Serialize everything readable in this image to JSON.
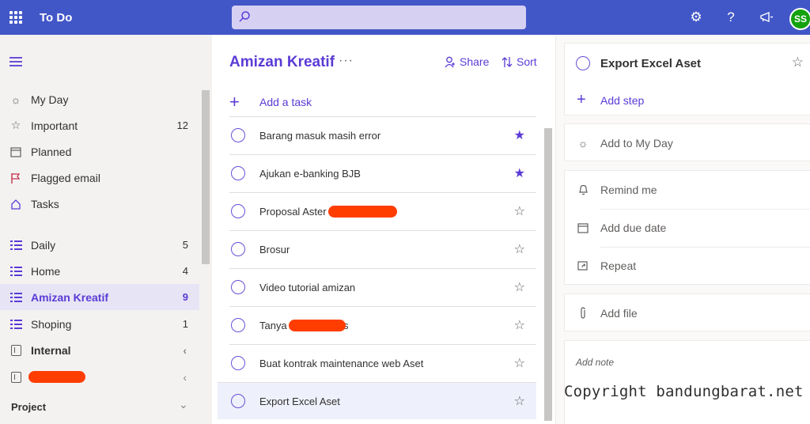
{
  "app": {
    "title": "To Do",
    "avatar_initials": "SS"
  },
  "colors": {
    "topbar": "#4257c7",
    "accent": "#5b3bd6",
    "avatar": "#13a10e",
    "redaction": "#ff3d00"
  },
  "topbar_icons": [
    "waffle-icon",
    "search-icon",
    "settings-icon",
    "help-icon",
    "megaphone-icon"
  ],
  "sidebar": {
    "items": [
      {
        "label": "My Day",
        "icon": "sun-icon",
        "count": ""
      },
      {
        "label": "Important",
        "icon": "star-icon",
        "count": "12"
      },
      {
        "label": "Planned",
        "icon": "calendar-icon",
        "count": ""
      },
      {
        "label": "Flagged email",
        "icon": "flag-icon",
        "count": ""
      },
      {
        "label": "Tasks",
        "icon": "home-icon",
        "count": ""
      }
    ],
    "lists": [
      {
        "label": "Daily",
        "count": "5"
      },
      {
        "label": "Home",
        "count": "4"
      },
      {
        "label": "Amizan Kreatif",
        "count": "9",
        "active": true
      },
      {
        "label": "Shoping",
        "count": "1"
      }
    ],
    "groups": [
      {
        "label": "Internal"
      },
      {
        "label": ""
      }
    ],
    "section": "Project"
  },
  "main": {
    "title": "Amizan Kreatif",
    "more": "···",
    "share_label": "Share",
    "sort_label": "Sort",
    "add_task_label": "Add a task",
    "tasks": [
      {
        "title": "Barang masuk masih error",
        "important": true
      },
      {
        "title": "Ajukan e-banking BJB",
        "important": true
      },
      {
        "title": "Proposal Aster",
        "important": false,
        "redacted": true
      },
      {
        "title": "Brosur",
        "important": false
      },
      {
        "title": "Video tutorial amizan",
        "important": false
      },
      {
        "title": "Tanya",
        "suffix": "s",
        "important": false,
        "redacted": true
      },
      {
        "title": "Buat kontrak maintenance web Aset",
        "important": false
      },
      {
        "title": "Export Excel Aset",
        "important": false,
        "selected": true
      }
    ]
  },
  "details": {
    "task_title": "Export Excel Aset",
    "add_step_label": "Add step",
    "add_to_my_day_label": "Add to My Day",
    "remind_me_label": "Remind me",
    "add_due_date_label": "Add due date",
    "repeat_label": "Repeat",
    "add_file_label": "Add file",
    "add_note_placeholder": "Add note"
  },
  "watermark": "Copyright bandungbarat.net"
}
